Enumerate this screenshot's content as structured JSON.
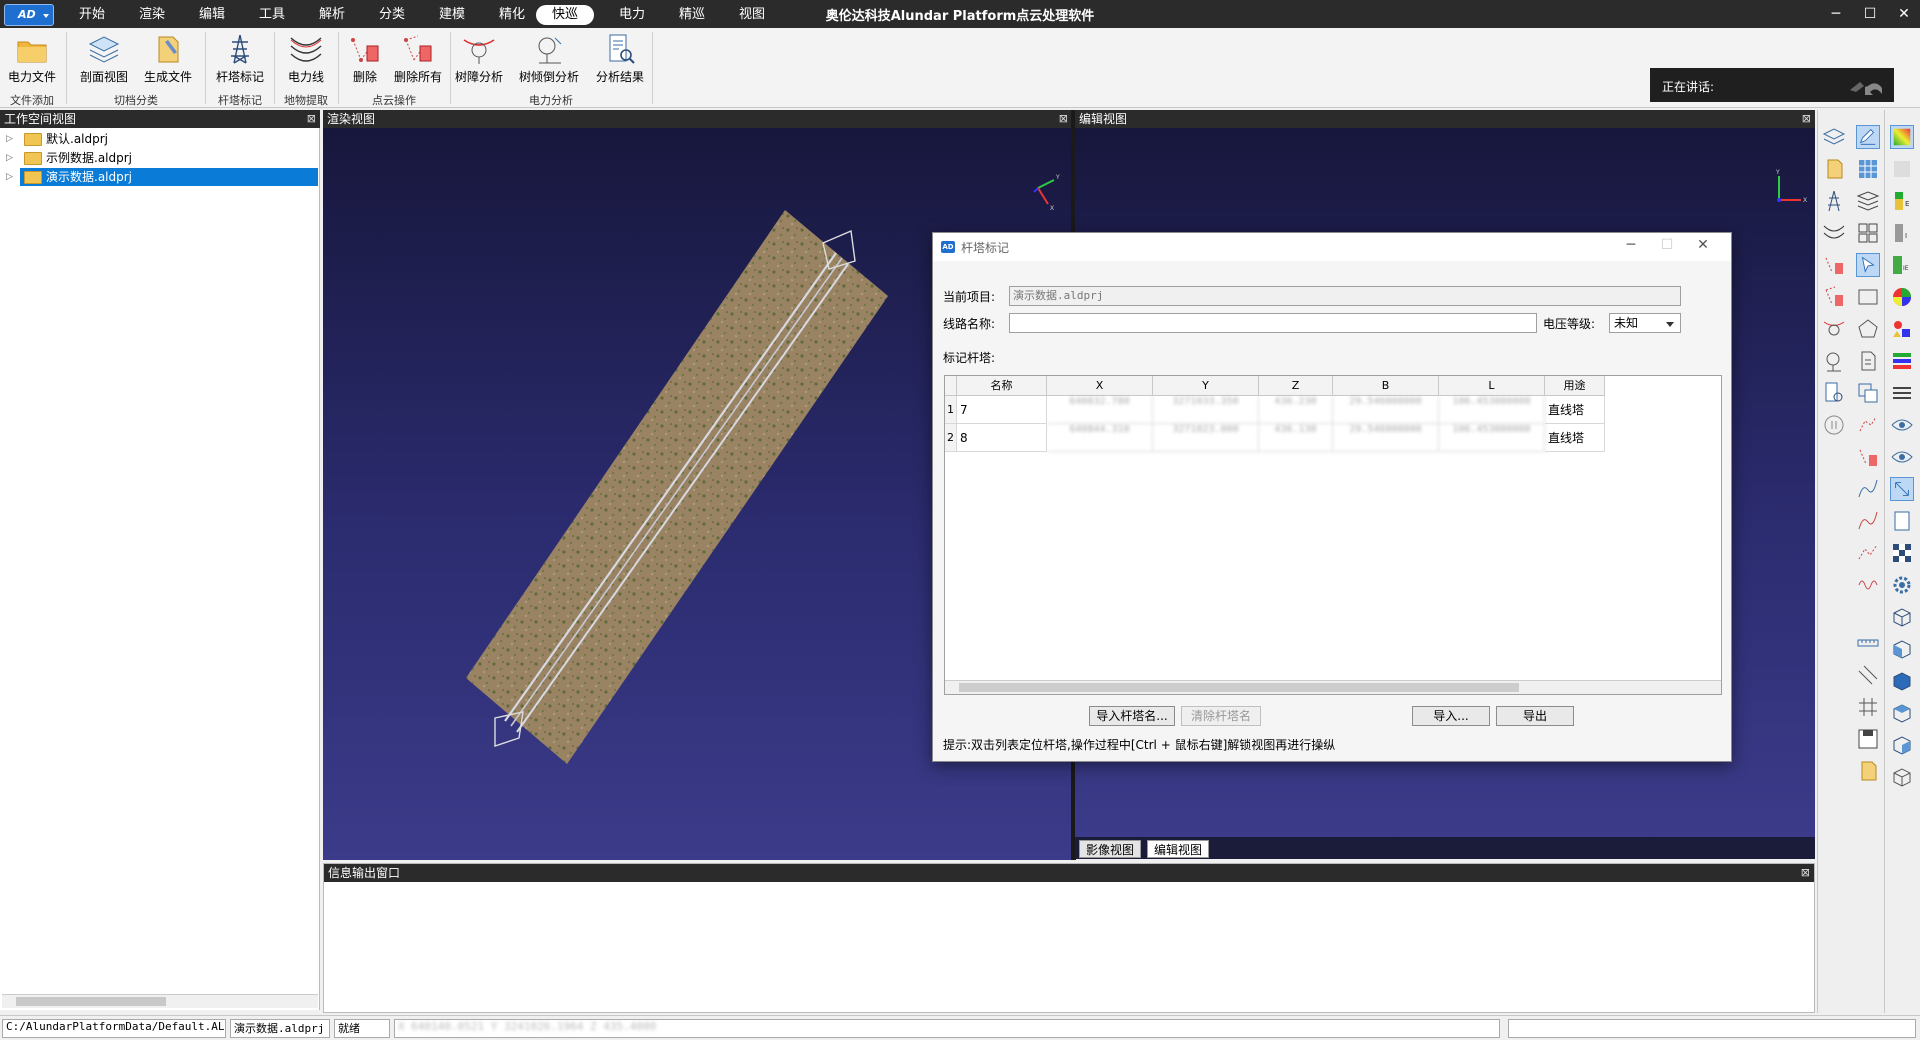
{
  "app": {
    "logo": "AD",
    "title": "奥伦达科技Alundar Platform点云处理软件",
    "menu": [
      "开始",
      "渲染",
      "编辑",
      "工具",
      "解析",
      "分类",
      "建模",
      "精化",
      "快巡",
      "电力",
      "精巡",
      "视图"
    ],
    "active_menu": "快巡"
  },
  "ribbon": {
    "buttons": {
      "power_file": "电力文件",
      "section_view": "剖面视图",
      "gen_file": "生成文件",
      "tower_mark": "杆塔标记",
      "power_line": "电力线",
      "delete": "删除",
      "delete_all": "删除所有",
      "tree_obstacle": "树障分析",
      "tree_fall": "树倾倒分析",
      "analysis_result": "分析结果"
    },
    "groups": {
      "file_add": "文件添加",
      "cut_classify": "切档分类",
      "tower_mark": "杆塔标记",
      "feature_extract": "地物提取",
      "pointcloud_ops": "点云操作",
      "power_analysis": "电力分析"
    },
    "speaking_label": "正在讲话:"
  },
  "workspace": {
    "title": "工作空间视图",
    "items": [
      "默认.aldprj",
      "示例数据.aldprj",
      "演示数据.aldprj"
    ],
    "selected": "演示数据.aldprj"
  },
  "views": {
    "render_title": "渲染视图",
    "edit_title": "编辑视图",
    "info_title": "信息输出窗口",
    "tabs": [
      "影像视图",
      "编辑视图"
    ],
    "active_tab": "编辑视图"
  },
  "dialog": {
    "title": "杆塔标记",
    "current_project_label": "当前项目:",
    "current_project_value": "演示数据.aldprj",
    "line_name_label": "线路名称:",
    "line_name_value": "",
    "voltage_label": "电压等级:",
    "voltage_value": "未知",
    "marked_towers_label": "标记杆塔:",
    "columns": [
      "名称",
      "X",
      "Y",
      "Z",
      "B",
      "L",
      "用途"
    ],
    "rows": [
      {
        "idx": "1",
        "name": "7",
        "x": "640832.780",
        "y": "3271033.350",
        "z": "436.230",
        "b": "29.546000000",
        "l": "106.453000000",
        "use": "直线塔"
      },
      {
        "idx": "2",
        "name": "8",
        "x": "640844.310",
        "y": "3271023.000",
        "z": "436.130",
        "b": "29.546000000",
        "l": "106.453000000",
        "use": "直线塔"
      }
    ],
    "buttons": {
      "import_names": "导入杆塔名...",
      "clear_names": "清除杆塔名",
      "import": "导入...",
      "export": "导出"
    },
    "hint": "提示:双击列表定位杆塔,操作过程中[Ctrl + 鼠标右键]解锁视图再进行操纵"
  },
  "statusbar": {
    "path": "C:/AlundarPlatformData/Default.ALDWS",
    "project": "演示数据.aldprj",
    "state": "就绪",
    "coords": "X  640140.0521  Y  3241026.1964  Z  435.4000"
  },
  "colors": {
    "titlebar": "#2b2b2b",
    "accent": "#1e6fd0",
    "view_top": "#16163a",
    "view_bottom": "#3b3b8a",
    "selection": "#0a7bd6"
  }
}
